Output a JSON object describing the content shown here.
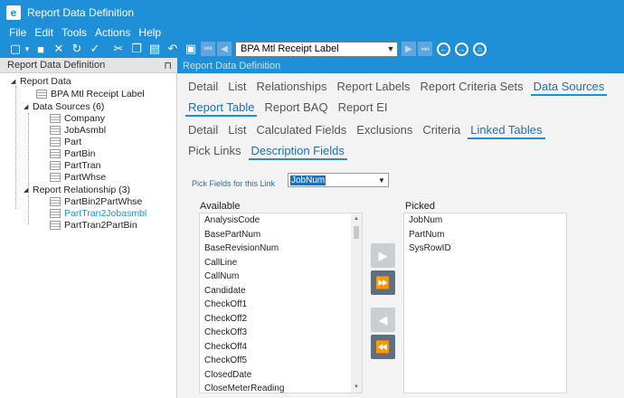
{
  "window": {
    "title": "Report Data Definition",
    "logo_letter": "e"
  },
  "menu": [
    "File",
    "Edit",
    "Tools",
    "Actions",
    "Help"
  ],
  "toolbar": {
    "icons": {
      "new": "▢",
      "new_arrow": "▾",
      "save": "■",
      "delete": "✕",
      "refresh": "↻",
      "clear": "✓",
      "cut": "✂",
      "copy": "❐",
      "paste": "▤",
      "undo": "↶",
      "attach": "▣",
      "first": "⏮",
      "prev": "◀",
      "next": "▶",
      "last": "⏭",
      "back": "←",
      "forward": "→",
      "home": "⌂"
    },
    "combo_value": "BPA Mtl Receipt Label"
  },
  "tree": {
    "header": "Report Data Definition",
    "pin": "⊓",
    "nodes": [
      {
        "label": "Report Data",
        "expanded": true
      },
      {
        "label": "BPA Mtl Receipt Label"
      },
      {
        "label": "Data Sources (6)",
        "expanded": true
      },
      {
        "label": "Company"
      },
      {
        "label": "JobAsmbl"
      },
      {
        "label": "Part"
      },
      {
        "label": "PartBin"
      },
      {
        "label": "PartTran"
      },
      {
        "label": "PartWhse"
      },
      {
        "label": "Report Relationship (3)",
        "expanded": true
      },
      {
        "label": "PartBin2PartWhse"
      },
      {
        "label": "PartTran2Jobasmbl",
        "selected": true
      },
      {
        "label": "PartTran2PartBin"
      }
    ]
  },
  "main": {
    "header": "Report Data Definition",
    "tabs_level1a": [
      "Detail",
      "List",
      "Relationships",
      "Report Labels",
      "Report Criteria Sets",
      "Data Sources"
    ],
    "tabs_level1b": [
      "Report Table",
      "Report BAQ",
      "Report EI"
    ],
    "tabs_level2a": [
      "Detail",
      "List",
      "Calculated Fields",
      "Exclusions",
      "Criteria",
      "Linked Tables"
    ],
    "tabs_level2b": [
      "Pick Links",
      "Description Fields"
    ],
    "pick_fields_label": "Pick Fields for this Link",
    "pick_fields_value": "JobNum",
    "available_title": "Available",
    "picked_title": "Picked",
    "available": [
      "AnalysisCode",
      "BasePartNum",
      "BaseRevisionNum",
      "CallLine",
      "CallNum",
      "Candidate",
      "CheckOff1",
      "CheckOff2",
      "CheckOff3",
      "CheckOff4",
      "CheckOff5",
      "ClosedDate",
      "CloseMeterReading"
    ],
    "picked": [
      "JobNum",
      "PartNum",
      "SysRowID"
    ],
    "buttons": {
      "add": "▶",
      "add_all": "⏩",
      "remove": "◀",
      "remove_all": "⏪"
    }
  },
  "colors": {
    "accent": "#1f8fd8",
    "tab_active": "#1f6fb8"
  }
}
